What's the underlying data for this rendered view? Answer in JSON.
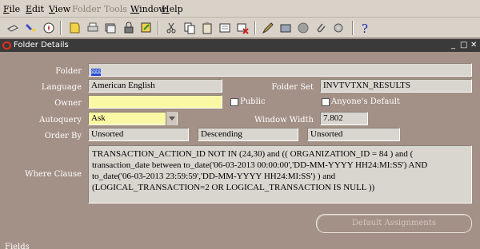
{
  "menu": [
    {
      "label": "File",
      "u": "F",
      "rest": "ile",
      "enabled": true
    },
    {
      "label": "Edit",
      "u": "E",
      "rest": "dit",
      "enabled": true
    },
    {
      "label": "View",
      "u": "V",
      "rest": "iew",
      "enabled": true
    },
    {
      "label": "Folder",
      "u": "",
      "rest": "Folder",
      "enabled": false
    },
    {
      "label": "Tools",
      "u": "",
      "rest": "Tools",
      "enabled": false
    },
    {
      "label": "Window",
      "u": "W",
      "rest": "indow",
      "enabled": true
    },
    {
      "label": "Help",
      "u": "H",
      "rest": "elp",
      "enabled": true
    }
  ],
  "window": {
    "title": "Folder Details",
    "controls": [
      "_",
      "□",
      "✕"
    ]
  },
  "form": {
    "folder_label": "Folder",
    "folder_value": "ggg",
    "language_label": "Language",
    "language_value": "American English",
    "folder_set_label": "Folder Set",
    "folder_set_value": "INVTVTXN_RESULTS",
    "owner_label": "Owner",
    "owner_value": "",
    "public_label": "Public",
    "anyones_default_label": "Anyone's Default",
    "autoquery_label": "Autoquery",
    "autoquery_value": "Ask",
    "window_width_label": "Window Width",
    "window_width_value": "7.802",
    "order_by_label": "Order By",
    "order_by": [
      "Unsorted",
      "Descending",
      "Unsorted"
    ],
    "where_clause_label": "Where Clause",
    "where_clause_lines": [
      "TRANSACTION_ACTION_ID NOT IN (24,30) and (( ORGANIZATION_ID = 84 ) and (",
      "transaction_date between to_date('06-03-2013 00:00:00','DD-MM-YYYY HH24:MI:SS') AND",
      "to_date('06-03-2013 23:59:59','DD-MM-YYYY HH24:MI:SS') ) and",
      "(LOGICAL_TRANSACTION=2 OR LOGICAL_TRANSACTION IS NULL ))"
    ],
    "default_assignments_label": "Default Assignments",
    "fields_label": "Fields"
  },
  "toolbar_icons": [
    "new-icon",
    "find-flashlight-icon",
    "navigator-icon",
    "save-icon",
    "print-icon",
    "stack-icon",
    "lock-icon",
    "zoom-icon",
    "cut-icon",
    "copy-icon",
    "paste-icon",
    "clear-record-icon",
    "delete-record-icon",
    "edit-field-icon",
    "folder-tools-icon",
    "translations-icon",
    "attachments-icon",
    "settings-icon",
    "help-icon"
  ]
}
